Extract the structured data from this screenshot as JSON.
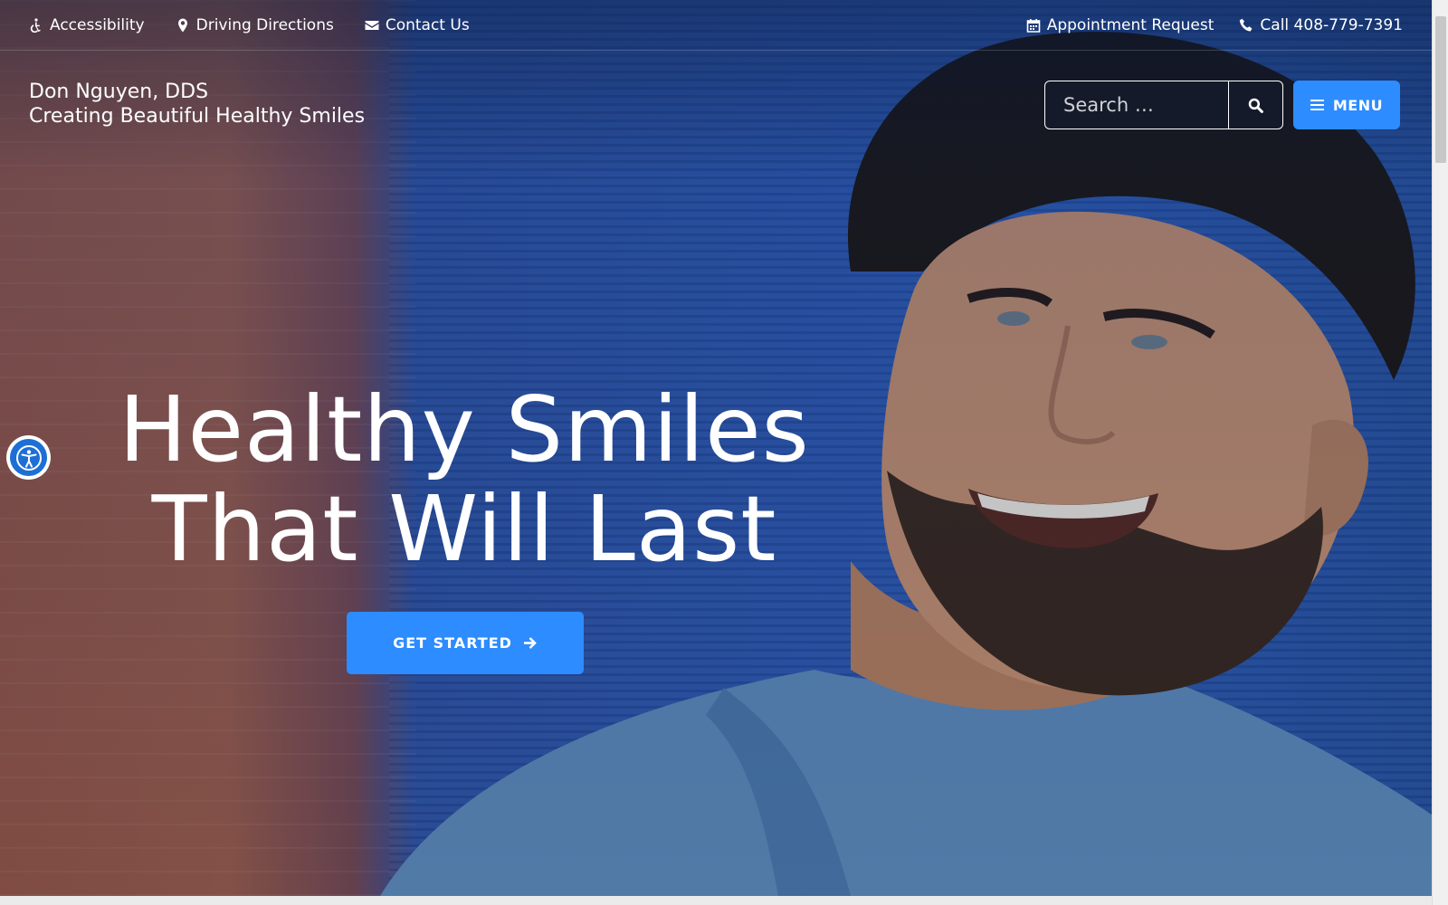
{
  "utility_bar": {
    "accessibility": "Accessibility",
    "directions": "Driving Directions",
    "contact": "Contact Us",
    "appointment": "Appointment Request",
    "call": "Call 408-779-7391"
  },
  "brand": {
    "name": "Don Nguyen, DDS",
    "tagline": "Creating Beautiful Healthy Smiles"
  },
  "search": {
    "placeholder": "Search …"
  },
  "menu": {
    "label": "MENU"
  },
  "hero": {
    "headline_line1": "Healthy Smiles",
    "headline_line2": "That Will Last",
    "cta_label": "GET STARTED"
  },
  "colors": {
    "accent_blue": "#2d8cff",
    "background_blue": "#2a56b2",
    "text": "#ffffff"
  },
  "icons": {
    "accessibility": "wheelchair-icon",
    "directions": "map-marker-icon",
    "contact": "envelope-icon",
    "appointment": "calendar-icon",
    "call": "phone-icon",
    "search": "search-icon",
    "menu": "hamburger-icon",
    "cta": "arrow-right-icon",
    "widget": "accessibility-person-icon"
  }
}
